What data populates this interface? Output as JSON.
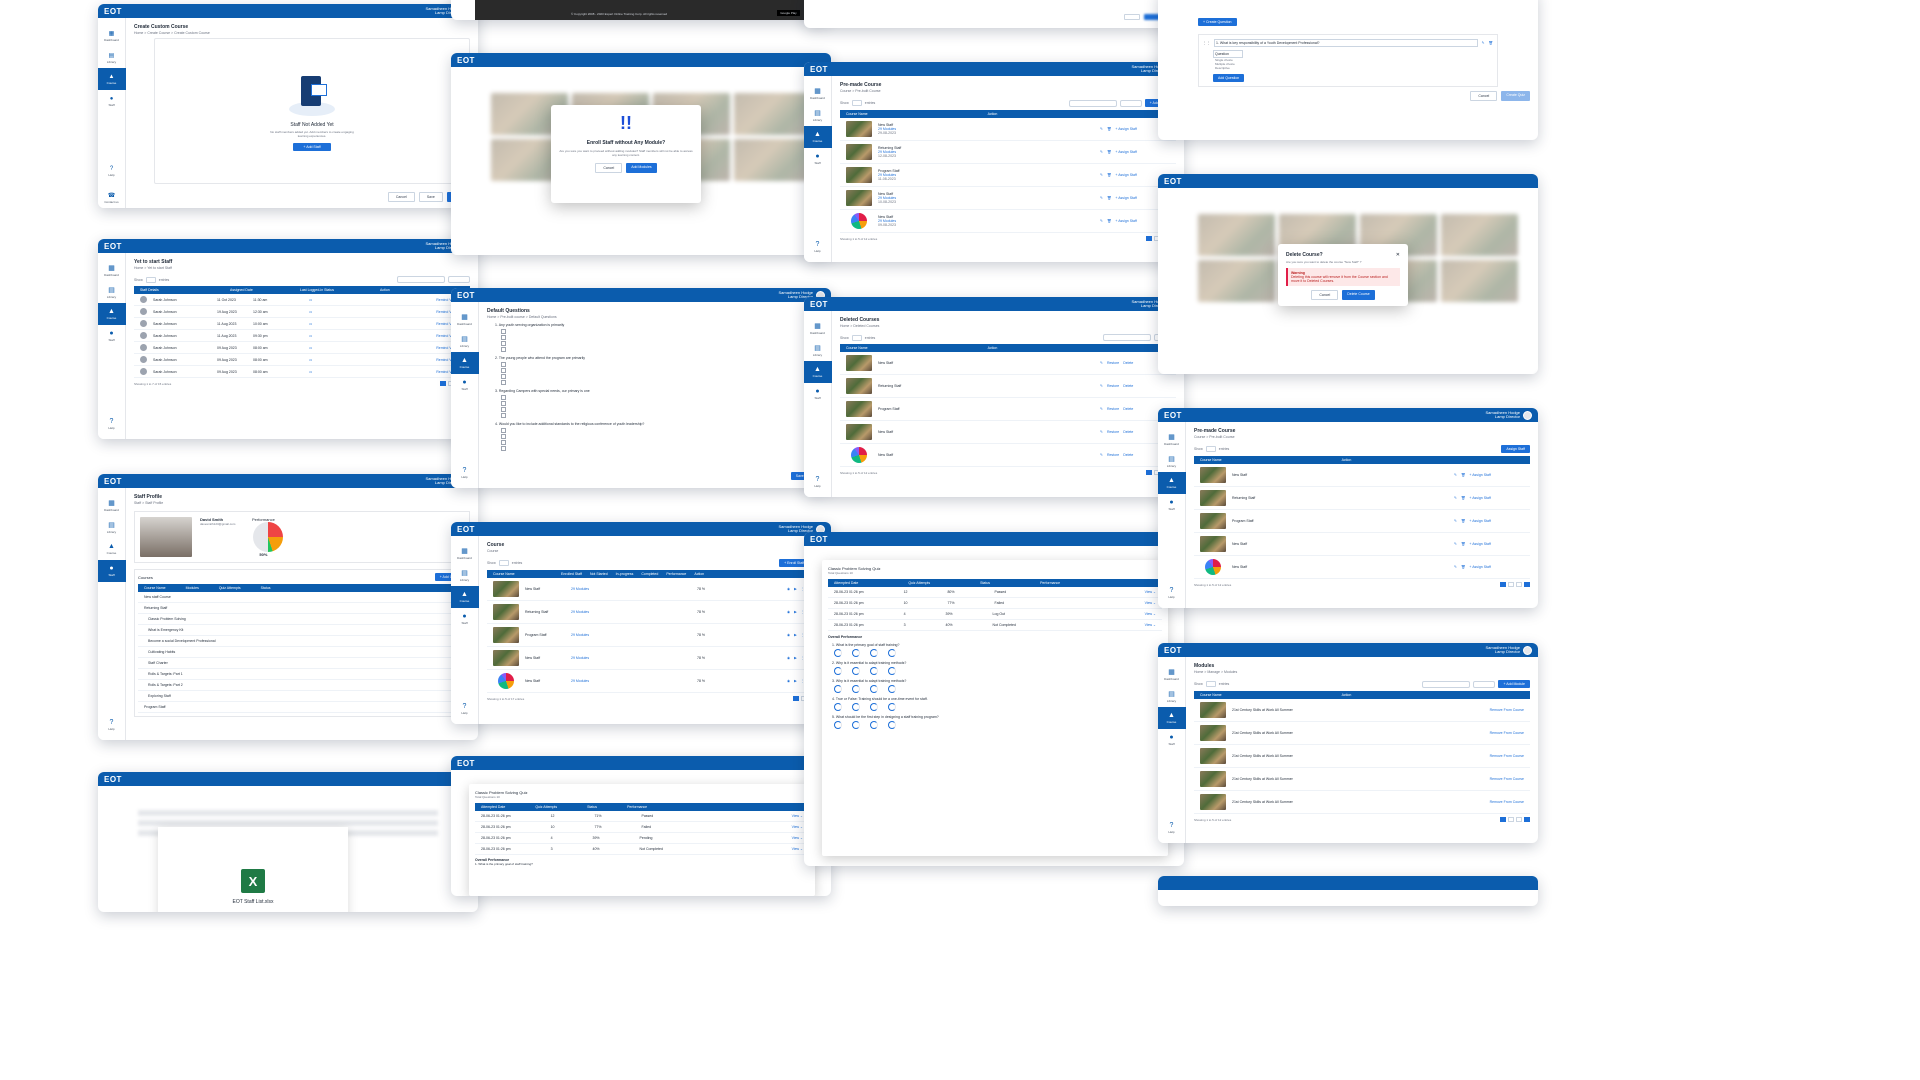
{
  "app": {
    "logo": "EOT",
    "user_name": "Samadheen Hodge",
    "user_role": "Lamp Director"
  },
  "sidebar": {
    "items": [
      "Dashboard",
      "Library",
      "Course",
      "Staff"
    ],
    "bottom": [
      "Help",
      "Contact us"
    ]
  },
  "screens": {
    "create_course": {
      "title": "Create Custom Course",
      "breadcrumb": "Home > Create Course > Create Custom Course",
      "empty_title": "Staff Not Added Yet",
      "empty_text": "No staff members added yet. Add members to create engaging learning experiences.",
      "add_button": "+ Add Staff",
      "cancel": "Cancel",
      "save": "Save",
      "next": "Next"
    },
    "yet_to_start": {
      "title": "Yet to start Staff",
      "breadcrumb": "Home > Yet to start Staff",
      "columns": [
        "Staff Details",
        "Assigned Date",
        "Last Logged-in Status",
        "Action"
      ],
      "rows": [
        {
          "name": "Sarah Johnson",
          "date": "11 Oct 2023",
          "time": "11:30 am"
        },
        {
          "name": "Sarah Johnson",
          "date": "19 Aug 2023",
          "time": "12:30 am"
        },
        {
          "name": "Sarah Johnson",
          "date": "11 Aug 2023",
          "time": "10:00 am"
        },
        {
          "name": "Sarah Johnson",
          "date": "11 Aug 2023",
          "time": "09:30 pm"
        },
        {
          "name": "Sarah Johnson",
          "date": "09 Aug 2023",
          "time": "08:00 am"
        },
        {
          "name": "Sarah Johnson",
          "date": "09 Aug 2023",
          "time": "08:00 am"
        },
        {
          "name": "Sarah Johnson",
          "date": "09 Aug 2023",
          "time": "08:00 am"
        }
      ],
      "action": "Remind Via Email",
      "footer": "Showing 1 to 7 of 15 entries"
    },
    "staff_profile": {
      "title": "Staff Profile",
      "breadcrumb": "Staff > Staff Profile",
      "name": "David Smith",
      "email": "davesmith123@gmail.com",
      "performance_label": "Performance",
      "performance_value": "50%",
      "courses_title": "Courses",
      "add_course": "+ Add Course",
      "course_rows": [
        "New staff Course",
        "Returning Staff",
        "Program Staff"
      ],
      "module_rows": [
        "Classic Problem Solving",
        "What is Emergency Kit",
        "Become a social Development Professional",
        "Cultivating Habits",
        "Staff Charter",
        "Rolls & Targets: Part 1",
        "Rolls & Targets: Part 2",
        "Exploring Staff"
      ]
    },
    "export": {
      "file": "EOT Staff List.xlsx"
    },
    "footer_strip": {
      "copyright": "© Copyright 2008 - 2023 Expert Online Training Corp. All rights reserved",
      "store1": "Google Play",
      "store2": "App Store"
    },
    "enroll_modal": {
      "title": "Enroll Staff without Any Module?",
      "text": "Are you sure you want to proceed without adding modules? Staff members will not be able to access any learning content.",
      "cancel": "Cancel",
      "confirm": "Add Modules"
    },
    "default_questions": {
      "title": "Default Questions",
      "breadcrumb": "Home > Pre-built course > Default Questions",
      "questions": [
        "1. Any youth serving organization is primarily",
        "2. The young people who attend the program are primarily",
        "3. Regarding Campers with special needs, our primary is one",
        "4. Would you like to include additional standards to the religious conference of youth leadership?"
      ],
      "save": "Save Update"
    },
    "course_list": {
      "title": "Course",
      "breadcrumb": "Course",
      "columns": [
        "Course Name",
        "Enrolled Staff",
        "Not Started",
        "In-progress",
        "Completed",
        "Performance",
        "Action"
      ],
      "rows": [
        {
          "name": "New Staff",
          "stat": "29 Modules"
        },
        {
          "name": "Returning Staff",
          "stat": "29 Modules"
        },
        {
          "name": "Program Staff",
          "stat": "29 Modules"
        },
        {
          "name": "New Staff",
          "stat": "29 Modules"
        },
        {
          "name": "New Staff",
          "stat": "29 Modules"
        }
      ],
      "perf": [
        "78 %",
        "78 %",
        "78 %",
        "78 %",
        "78 %"
      ],
      "enroll": "+ Enroll Staff Member",
      "footer": "Showing 1 to 5 of 17 entries"
    },
    "quiz_small": {
      "title": "Classic Problem Solving Quiz",
      "sub": "Total Questions 10",
      "columns": [
        "Attempted Date",
        "Quiz Attempts",
        "Status",
        "Performance"
      ],
      "rows": [
        {
          "date": "28-06-23  01:26 pm",
          "att": "12",
          "st": "71%",
          "perf": "Passed"
        },
        {
          "date": "28-06-23  01:26 pm",
          "att": "10",
          "st": "77%",
          "perf": "Failed"
        },
        {
          "date": "28-06-23  01:26 pm",
          "att": "4",
          "st": "39%",
          "perf": "Pending"
        },
        {
          "date": "28-06-23  01:26 pm",
          "att": "3",
          "st": "40%",
          "perf": "Not Completed"
        }
      ],
      "overall": "Overall Performance",
      "q1": "1. What is the primary goal of staff training?"
    },
    "prebuilt": {
      "title": "Pre-made Course",
      "breadcrumb": "Course > Pre-built Course",
      "columns": [
        "Course Name",
        "Action"
      ],
      "rows": [
        {
          "name": "New Staff",
          "stat": "29 Modules",
          "date": "29-08-2023"
        },
        {
          "name": "Returning Staff",
          "stat": "29 Modules",
          "date": "12-08-2023"
        },
        {
          "name": "Program Staff",
          "stat": "29 Modules",
          "date": "11-08-2023"
        },
        {
          "name": "New Staff",
          "stat": "29 Modules",
          "date": "10-08-2023"
        },
        {
          "name": "New Staff",
          "stat": "29 Modules",
          "date": "09-08-2023"
        }
      ],
      "action": "+ Assign Staff",
      "add": "+ Add Course",
      "footer": "Showing 1 to 5 of 12 entries"
    },
    "deleted": {
      "title": "Deleted Courses",
      "breadcrumb": "Home > Deleted Courses",
      "columns": [
        "Course Name",
        "Action"
      ],
      "rows": [
        "New Staff",
        "Returning Staff",
        "Program Staff",
        "New Staff",
        "New Staff"
      ],
      "restore": "Restore",
      "delete": "Delete",
      "footer": "Showing 1 to 5 of 12 entries"
    },
    "quiz_large": {
      "title": "Classic Problem Solving Quiz",
      "sub": "Total Questions 10",
      "columns": [
        "Attempted Date",
        "Quiz Attempts",
        "Status",
        "Performance"
      ],
      "rows": [
        {
          "date": "28-06-23  01:26 pm",
          "att": "12",
          "st": "80%",
          "perf": "Passed"
        },
        {
          "date": "28-06-23  01:26 pm",
          "att": "10",
          "st": "77%",
          "perf": "Failed"
        },
        {
          "date": "28-06-23  01:26 pm",
          "att": "4",
          "st": "39%",
          "perf": "Log Out"
        },
        {
          "date": "28-06-23  01:26 pm",
          "att": "3",
          "st": "40%",
          "perf": "Not Completed"
        }
      ],
      "questions": [
        "1. What is the primary goal of staff training?",
        "2. Why is it essential to adapt training methods?",
        "3. How do you ensure effective training outcomes?",
        "4. True or False: Training should be a one-time event for staff.",
        "5. What should be the first step in designing a staff training program?"
      ],
      "overall": "Overall Performance",
      "overall_q": [
        "1. What is the primary goal of staff training?",
        "2. Why is it essential to adapt training methods?",
        "3. Why is it essential to adapt training methods?",
        "4. True or False: Training should be a one-time event for staff.",
        "5. What should be the first step in designing a staff training program?"
      ]
    },
    "create_question": {
      "btn": "+ Create Question",
      "q": "1. What is key responsibility of a Youth Development Professional?",
      "type": "Question",
      "types": [
        "Single choice",
        "Multiple choice",
        "Descriptive"
      ],
      "add": "Add Question",
      "cancel": "Cancel",
      "save": "Create Quiz"
    },
    "delete_modal": {
      "title": "Delete Course?",
      "text": "Are you sure you want to delete the course \"New Staff\" ?",
      "warn_title": "Warning",
      "warn": "Deleting this course will remove it from the Course section and move it to Deleted Courses.",
      "cancel": "Cancel",
      "confirm": "Delete Course"
    },
    "prebuilt_select": {
      "title": "Pre-made Course",
      "breadcrumb": "Course > Pre-built Course",
      "rows": [
        "New Staff",
        "Returning Staff",
        "Program Staff",
        "New Staff",
        "New Staff"
      ],
      "assign": "Assign Staff",
      "footer": "Showing 1 to 5 of 12 entries"
    },
    "modules": {
      "title": "Modules",
      "breadcrumb": "Home > Manage > Modules",
      "columns": [
        "Course Name",
        "Action"
      ],
      "rows": [
        "21st Century Skills at Work All Summer",
        "21st Century Skills at Work All Summer",
        "21st Century Skills at Work All Summer",
        "21st Century Skills at Work All Summer",
        "21st Century Skills at Work All Summer"
      ],
      "action": "Remove From Course",
      "add": "+ Add Module",
      "footer": "Showing 1 to 5 of 12 entries"
    }
  }
}
